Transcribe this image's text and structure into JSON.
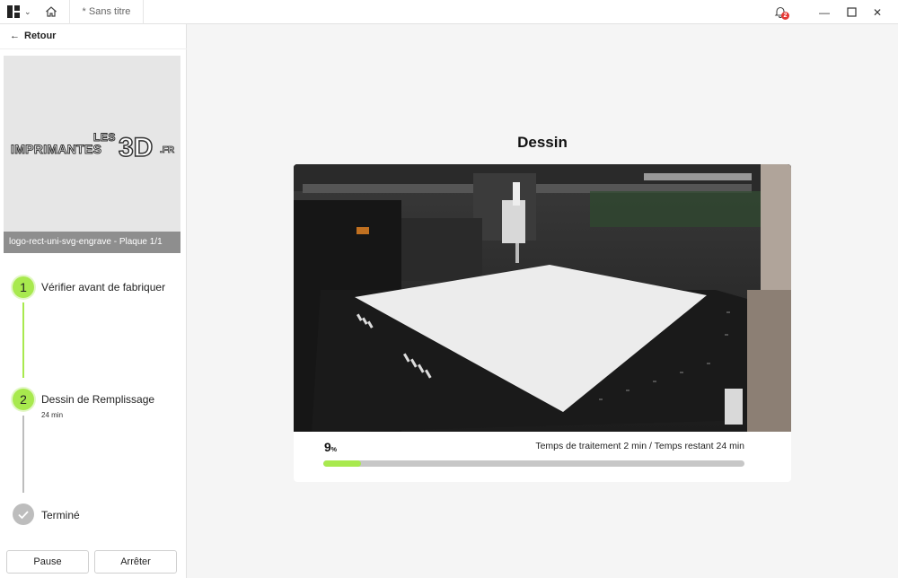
{
  "titlebar": {
    "doc_title": "* Sans titre",
    "notification_count": "2"
  },
  "left": {
    "back_label": "Retour",
    "thumbnail_caption": "logo-rect-uni-svg-engrave - Plaque 1/1",
    "logo": {
      "les": "LES",
      "main": "IMPRIMANTES",
      "three_d": "3D",
      "fr": ".FR"
    },
    "steps": [
      {
        "number": "1",
        "label": "Vérifier avant de fabriquer",
        "sub": "",
        "state": "active"
      },
      {
        "number": "2",
        "label": "Dessin de Remplissage",
        "sub": "24 min",
        "state": "active"
      },
      {
        "number": "",
        "label": "Terminé",
        "sub": "",
        "state": "pending"
      }
    ],
    "pause_label": "Pause",
    "stop_label": "Arrêter"
  },
  "main": {
    "title": "Dessin",
    "progress_value": "9",
    "progress_unit": "%",
    "progress_fraction": 0.09,
    "time_text": "Temps de traitement 2 min / Temps restant 24 min"
  },
  "colors": {
    "accent": "#a8e94e",
    "badge": "#e53935"
  }
}
